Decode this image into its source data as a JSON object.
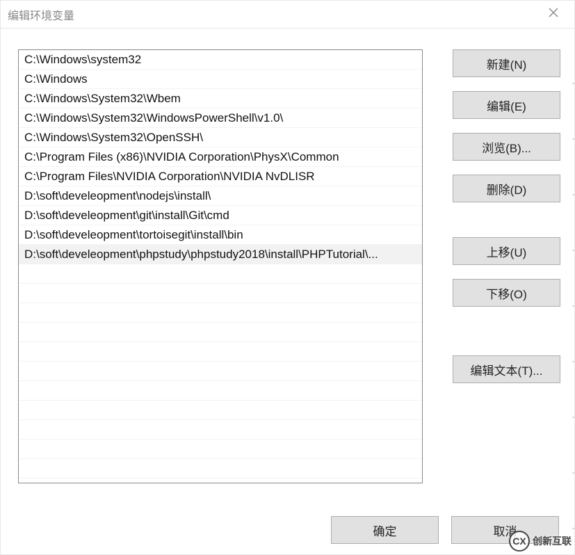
{
  "window": {
    "title": "编辑环境变量"
  },
  "list": {
    "items": [
      "C:\\Windows\\system32",
      "C:\\Windows",
      "C:\\Windows\\System32\\Wbem",
      "C:\\Windows\\System32\\WindowsPowerShell\\v1.0\\",
      "C:\\Windows\\System32\\OpenSSH\\",
      "C:\\Program Files (x86)\\NVIDIA Corporation\\PhysX\\Common",
      "C:\\Program Files\\NVIDIA Corporation\\NVIDIA NvDLISR",
      "D:\\soft\\develeopment\\nodejs\\install\\",
      "D:\\soft\\develeopment\\git\\install\\Git\\cmd",
      "D:\\soft\\develeopment\\tortoisegit\\install\\bin",
      "D:\\soft\\develeopment\\phpstudy\\phpstudy2018\\install\\PHPTutorial\\..."
    ],
    "selected_index": 10
  },
  "buttons": {
    "new": "新建(N)",
    "edit": "编辑(E)",
    "browse": "浏览(B)...",
    "delete": "删除(D)",
    "move_up": "上移(U)",
    "move_down": "下移(O)",
    "edit_text": "编辑文本(T)...",
    "ok": "确定",
    "cancel": "取消"
  },
  "watermark": {
    "badge": "CX",
    "text": "创新互联"
  }
}
